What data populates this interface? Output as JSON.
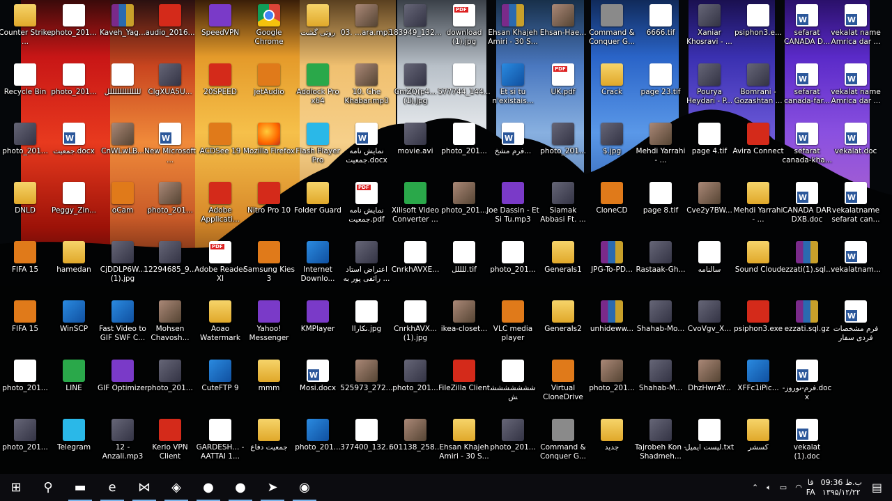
{
  "desktop": {
    "icons": [
      {
        "label": "Counter Strike ...",
        "type": "folder",
        "col": 0,
        "row": 0
      },
      {
        "label": "Recycle Bin",
        "type": "doc",
        "col": 0,
        "row": 1
      },
      {
        "label": "photo_201...",
        "type": "photo",
        "col": 0,
        "row": 2
      },
      {
        "label": "DNLD",
        "type": "folder",
        "col": 0,
        "row": 3
      },
      {
        "label": "FIFA 15",
        "type": "orange",
        "col": 0,
        "row": 4
      },
      {
        "label": "FIFA 15",
        "type": "orange",
        "col": 0,
        "row": 5
      },
      {
        "label": "photo_201...",
        "type": "doc",
        "col": 0,
        "row": 6
      },
      {
        "label": "photo_201...",
        "type": "photo",
        "col": 0,
        "row": 7
      },
      {
        "label": "photo_201...",
        "type": "doc",
        "col": 1,
        "row": 0
      },
      {
        "label": "photo_201...",
        "type": "doc",
        "col": 1,
        "row": 1
      },
      {
        "label": "جمعیت.docx",
        "type": "word",
        "col": 1,
        "row": 2
      },
      {
        "label": "Peggy_Zin...",
        "type": "doc",
        "col": 1,
        "row": 3
      },
      {
        "label": "hamedan",
        "type": "folder",
        "col": 1,
        "row": 4
      },
      {
        "label": "WinSCP",
        "type": "exe-blue",
        "col": 1,
        "row": 5
      },
      {
        "label": "LINE",
        "type": "green",
        "col": 1,
        "row": 6
      },
      {
        "label": "Telegram",
        "type": "cyan",
        "col": 1,
        "row": 7
      },
      {
        "label": "Kaveh_Yag...",
        "type": "rar",
        "col": 2,
        "row": 0
      },
      {
        "label": "لللللللللللللل",
        "type": "doc",
        "col": 2,
        "row": 1
      },
      {
        "label": "CnWLwLB...",
        "type": "photo2",
        "col": 2,
        "row": 2
      },
      {
        "label": "oCam",
        "type": "orange",
        "col": 2,
        "row": 3
      },
      {
        "label": "CjDDLP6W... (1).jpg",
        "type": "photo",
        "col": 2,
        "row": 4
      },
      {
        "label": "Fast Video to GIF SWF C...",
        "type": "exe-blue",
        "col": 2,
        "row": 5
      },
      {
        "label": "GIF Optimizer",
        "type": "purple",
        "col": 2,
        "row": 6
      },
      {
        "label": "12 - Anzali.mp3",
        "type": "photo",
        "col": 2,
        "row": 7
      },
      {
        "label": "audio_2016...",
        "type": "red",
        "col": 3,
        "row": 0
      },
      {
        "label": "ClgXUA5U...",
        "type": "photo",
        "col": 3,
        "row": 1
      },
      {
        "label": "New Microsoft ...",
        "type": "word",
        "col": 3,
        "row": 2
      },
      {
        "label": "photo_201...",
        "type": "photo2",
        "col": 3,
        "row": 3
      },
      {
        "label": "12294685_9...",
        "type": "photo",
        "col": 3,
        "row": 4
      },
      {
        "label": "Mohsen Chavosh...",
        "type": "photo2",
        "col": 3,
        "row": 5
      },
      {
        "label": "photo_201...",
        "type": "photo",
        "col": 3,
        "row": 6
      },
      {
        "label": "Kerio VPN Client",
        "type": "red",
        "col": 3,
        "row": 7
      },
      {
        "label": "SpeedVPN",
        "type": "purple",
        "col": 4,
        "row": 0
      },
      {
        "label": "20SPEED",
        "type": "red",
        "col": 4,
        "row": 1
      },
      {
        "label": "ACDSee 19",
        "type": "orange",
        "col": 4,
        "row": 2
      },
      {
        "label": "Adobe Applicati...",
        "type": "red",
        "col": 4,
        "row": 3
      },
      {
        "label": "Adobe Reader XI",
        "type": "pdf",
        "col": 4,
        "row": 4
      },
      {
        "label": "Aoao Watermark",
        "type": "folder",
        "col": 4,
        "row": 5
      },
      {
        "label": "CuteFTP 9",
        "type": "exe-blue",
        "col": 4,
        "row": 6
      },
      {
        "label": "GARDESH... - AATTAI 1...",
        "type": "doc",
        "col": 4,
        "row": 7
      },
      {
        "label": "Google Chrome",
        "type": "chrome",
        "col": 5,
        "row": 0
      },
      {
        "label": "jetAudio",
        "type": "orange",
        "col": 5,
        "row": 1
      },
      {
        "label": "Mozilla Firefox",
        "type": "firefox",
        "col": 5,
        "row": 2
      },
      {
        "label": "Nitro Pro 10",
        "type": "red",
        "col": 5,
        "row": 3
      },
      {
        "label": "Samsung Kies 3",
        "type": "orange",
        "col": 5,
        "row": 4
      },
      {
        "label": "Yahoo! Messenger",
        "type": "purple",
        "col": 5,
        "row": 5
      },
      {
        "label": "mmm",
        "type": "folder",
        "col": 5,
        "row": 6
      },
      {
        "label": "جمعیت دفاع",
        "type": "folder",
        "col": 5,
        "row": 7
      },
      {
        "label": "روتی گشت",
        "type": "folder",
        "col": 6,
        "row": 0
      },
      {
        "label": "Adolock Pro x64",
        "type": "green",
        "col": 6,
        "row": 1
      },
      {
        "label": "Flash Player Pro",
        "type": "cyan",
        "col": 6,
        "row": 2
      },
      {
        "label": "Folder Guard",
        "type": "folder",
        "col": 6,
        "row": 3
      },
      {
        "label": "Internet Downlo...",
        "type": "exe-blue",
        "col": 6,
        "row": 4
      },
      {
        "label": "KMPlayer",
        "type": "purple",
        "col": 6,
        "row": 5
      },
      {
        "label": "Mosi.docx",
        "type": "word",
        "col": 6,
        "row": 6
      },
      {
        "label": "photo_201...",
        "type": "exe-blue",
        "col": 6,
        "row": 7
      },
      {
        "label": "03. ...ara.mp3",
        "type": "photo2",
        "col": 7,
        "row": 0
      },
      {
        "label": "10. Che Khabar.mp3",
        "type": "photo2",
        "col": 7,
        "row": 1
      },
      {
        "label": "نمایش نامه جمعیت.docx",
        "type": "word",
        "col": 7,
        "row": 2
      },
      {
        "label": "نمایش نامه جمعیت.pdf",
        "type": "pdf",
        "col": 7,
        "row": 3
      },
      {
        "label": "اعتراض استاد رائفی پور به ...",
        "type": "photo",
        "col": 7,
        "row": 4
      },
      {
        "label": "نکاراا.jpg",
        "type": "doc",
        "col": 7,
        "row": 5
      },
      {
        "label": "525973_272...",
        "type": "photo2",
        "col": 7,
        "row": 6
      },
      {
        "label": "377400_132...",
        "type": "doc",
        "col": 7,
        "row": 7
      },
      {
        "label": "183949_132...",
        "type": "photo",
        "col": 8,
        "row": 0
      },
      {
        "label": "CmZQ(p4... (1).jpg",
        "type": "photo",
        "col": 8,
        "row": 1
      },
      {
        "label": "movie.avi",
        "type": "photo",
        "col": 8,
        "row": 2
      },
      {
        "label": "Xilisoft Video Converter ...",
        "type": "green",
        "col": 8,
        "row": 3
      },
      {
        "label": "CnrkhAVXE...",
        "type": "doc",
        "col": 8,
        "row": 4
      },
      {
        "label": "CnrkhAVX... (1).jpg",
        "type": "doc",
        "col": 8,
        "row": 5
      },
      {
        "label": "photo_201...",
        "type": "photo",
        "col": 8,
        "row": 6
      },
      {
        "label": "601138_258...",
        "type": "photo2",
        "col": 8,
        "row": 7
      },
      {
        "label": "download (1).jpg",
        "type": "pdf",
        "col": 9,
        "row": 0
      },
      {
        "label": "577744_144...",
        "type": "doc",
        "col": 9,
        "row": 1
      },
      {
        "label": "photo_201...",
        "type": "doc",
        "col": 9,
        "row": 2
      },
      {
        "label": "photo_201...",
        "type": "photo2",
        "col": 9,
        "row": 3
      },
      {
        "label": "للللل.tif",
        "type": "doc",
        "col": 9,
        "row": 4
      },
      {
        "label": "ikea-closet...",
        "type": "photo2",
        "col": 9,
        "row": 5
      },
      {
        "label": "FileZilla Client",
        "type": "red",
        "col": 9,
        "row": 6
      },
      {
        "label": "Ehsan Khajeh Amiri - 30 S...",
        "type": "folder",
        "col": 9,
        "row": 7
      },
      {
        "label": "Ehsan Khajeh Amiri - 30 S...",
        "type": "rar",
        "col": 10,
        "row": 0
      },
      {
        "label": "Et si tu n'existais...",
        "type": "exe-blue",
        "col": 10,
        "row": 1
      },
      {
        "label": "فرم مشخ...",
        "type": "word",
        "col": 10,
        "row": 2
      },
      {
        "label": "Joe Dassin - Et Si Tu.mp3",
        "type": "purple",
        "col": 10,
        "row": 3
      },
      {
        "label": "photo_201...",
        "type": "doc",
        "col": 10,
        "row": 4
      },
      {
        "label": "VLC media player",
        "type": "orange",
        "col": 10,
        "row": 5
      },
      {
        "label": "شششششششش",
        "type": "doc",
        "col": 10,
        "row": 6
      },
      {
        "label": "photo_201...",
        "type": "photo",
        "col": 10,
        "row": 7
      },
      {
        "label": "Ehsan-Hae...",
        "type": "photo2",
        "col": 11,
        "row": 0
      },
      {
        "label": "UK.pdf",
        "type": "pdf",
        "col": 11,
        "row": 1
      },
      {
        "label": "photo_201...",
        "type": "photo",
        "col": 11,
        "row": 2
      },
      {
        "label": "Siamak Abbasi Ft. ...",
        "type": "photo",
        "col": 11,
        "row": 3
      },
      {
        "label": "Generals1",
        "type": "folder",
        "col": 11,
        "row": 4
      },
      {
        "label": "Generals2",
        "type": "folder",
        "col": 11,
        "row": 5
      },
      {
        "label": "Virtual CloneDrive",
        "type": "orange",
        "col": 11,
        "row": 6
      },
      {
        "label": "Command & Conquer G...",
        "type": "grey",
        "col": 11,
        "row": 7
      },
      {
        "label": "Command & Conquer G...",
        "type": "grey",
        "col": 12,
        "row": 0
      },
      {
        "label": "Crack",
        "type": "folder",
        "col": 12,
        "row": 1
      },
      {
        "label": "$.jpg",
        "type": "photo",
        "col": 12,
        "row": 2
      },
      {
        "label": "CloneCD",
        "type": "orange",
        "col": 12,
        "row": 3
      },
      {
        "label": "JPG-To-PD...",
        "type": "rar",
        "col": 12,
        "row": 4
      },
      {
        "label": "unhideww...",
        "type": "rar",
        "col": 12,
        "row": 5
      },
      {
        "label": "photo_201...",
        "type": "photo2",
        "col": 12,
        "row": 6
      },
      {
        "label": "جدید",
        "type": "folder",
        "col": 12,
        "row": 7
      },
      {
        "label": "6666.tif",
        "type": "doc",
        "col": 13,
        "row": 0
      },
      {
        "label": "page 23.tif",
        "type": "doc",
        "col": 13,
        "row": 1
      },
      {
        "label": "Mehdi Yarrahi - ...",
        "type": "photo2",
        "col": 13,
        "row": 2
      },
      {
        "label": "page 8.tif",
        "type": "doc",
        "col": 13,
        "row": 3
      },
      {
        "label": "Rastaak-Gh...",
        "type": "photo",
        "col": 13,
        "row": 4
      },
      {
        "label": "Shahab-Mo...",
        "type": "photo",
        "col": 13,
        "row": 5
      },
      {
        "label": "Shahab-M...",
        "type": "photo",
        "col": 13,
        "row": 6
      },
      {
        "label": "Tajrobeh Kon - Shadmeh...",
        "type": "photo",
        "col": 13,
        "row": 7
      },
      {
        "label": "Xaniar Khosravi - ...",
        "type": "photo",
        "col": 14,
        "row": 0
      },
      {
        "label": "Pourya Heydari - P...",
        "type": "photo",
        "col": 14,
        "row": 1
      },
      {
        "label": "page 4.tif",
        "type": "doc",
        "col": 14,
        "row": 2
      },
      {
        "label": "Cve2y7BW...",
        "type": "photo2",
        "col": 14,
        "row": 3
      },
      {
        "label": "سالنامه",
        "type": "doc",
        "col": 14,
        "row": 4
      },
      {
        "label": "CvoVgv_X...",
        "type": "photo",
        "col": 14,
        "row": 5
      },
      {
        "label": "DhzHwrAY...",
        "type": "photo2",
        "col": 14,
        "row": 6
      },
      {
        "label": "لیست ایمیل.txt",
        "type": "doc",
        "col": 14,
        "row": 7
      },
      {
        "label": "psiphon3.e...",
        "type": "doc",
        "col": 15,
        "row": 0
      },
      {
        "label": "Bomrani - Gozashtan ...",
        "type": "photo",
        "col": 15,
        "row": 1
      },
      {
        "label": "Avira Connect",
        "type": "red",
        "col": 15,
        "row": 2
      },
      {
        "label": "Mehdi Yarrahi - ...",
        "type": "folder",
        "col": 15,
        "row": 3
      },
      {
        "label": "Sound Cloud",
        "type": "folder",
        "col": 15,
        "row": 4
      },
      {
        "label": "psiphon3.exe",
        "type": "red",
        "col": 15,
        "row": 5
      },
      {
        "label": "XFFc1iPic...",
        "type": "exe-blue",
        "col": 15,
        "row": 6
      },
      {
        "label": "کسشر",
        "type": "folder",
        "col": 15,
        "row": 7
      },
      {
        "label": "sefarat CANADA D...",
        "type": "word",
        "col": 16,
        "row": 0
      },
      {
        "label": "sefarat canada-far...",
        "type": "word",
        "col": 16,
        "row": 1
      },
      {
        "label": "sefarat canada-kha...",
        "type": "word",
        "col": 16,
        "row": 2
      },
      {
        "label": "CANADA DAR DXB.doc",
        "type": "word",
        "col": 16,
        "row": 3
      },
      {
        "label": "ezzati(1).sql...",
        "type": "rar",
        "col": 16,
        "row": 4
      },
      {
        "label": "ezzati.sql.gz",
        "type": "rar",
        "col": 16,
        "row": 5
      },
      {
        "label": "-فرم-نوروز.doc x",
        "type": "word",
        "col": 16,
        "row": 6
      },
      {
        "label": "vekalat (1).doc",
        "type": "word",
        "col": 16,
        "row": 7
      },
      {
        "label": "vekalat name Amrica dar ...",
        "type": "word",
        "col": 17,
        "row": 0
      },
      {
        "label": "vekalat name Amrica dar ...",
        "type": "word",
        "col": 17,
        "row": 1
      },
      {
        "label": "vekalat.doc",
        "type": "word",
        "col": 17,
        "row": 2
      },
      {
        "label": "vekalatname sefarat can...",
        "type": "word",
        "col": 17,
        "row": 3
      },
      {
        "label": "vekalatnam...",
        "type": "word",
        "col": 17,
        "row": 4
      },
      {
        "label": "فرم مشخصات فردی سفار",
        "type": "word",
        "col": 17,
        "row": 5
      }
    ]
  },
  "taskbar": {
    "pinned": [
      {
        "name": "start-button",
        "glyph": "⊞"
      },
      {
        "name": "search-button",
        "glyph": "⚲"
      },
      {
        "name": "file-explorer-icon",
        "glyph": "▬"
      },
      {
        "name": "edge-icon",
        "glyph": "e"
      },
      {
        "name": "kmplayer-icon",
        "glyph": "⋈"
      },
      {
        "name": "red-app-icon",
        "glyph": "◈"
      },
      {
        "name": "chrome-taskbar-icon",
        "glyph": "●"
      },
      {
        "name": "firefox-taskbar-icon",
        "glyph": "●"
      },
      {
        "name": "telegram-taskbar-icon",
        "glyph": "➤"
      },
      {
        "name": "idm-taskbar-icon",
        "glyph": "◉"
      }
    ],
    "tray": {
      "lang_top": "فا",
      "lang_bottom": "FA",
      "time": "09:36 ب.ظ",
      "date": "۱۳۹۵/۱۲/۲۲"
    }
  },
  "colors": {
    "taskbar_bg": "#0c0c10",
    "accent": "#7ab4ea"
  }
}
